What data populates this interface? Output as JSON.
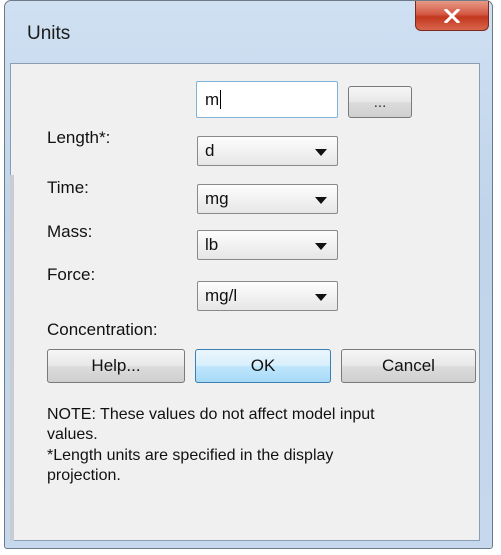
{
  "window": {
    "title": "Units"
  },
  "fields": {
    "length": {
      "label": "Length*:",
      "value": "m",
      "browse_label": "..."
    },
    "time": {
      "label": "Time:",
      "value": "d"
    },
    "mass": {
      "label": "Mass:",
      "value": "mg"
    },
    "force": {
      "label": "Force:",
      "value": "lb"
    },
    "concentration": {
      "label": "Concentration:",
      "value": "mg/l"
    }
  },
  "buttons": {
    "help": "Help...",
    "ok": "OK",
    "cancel": "Cancel"
  },
  "notes": {
    "line1": "NOTE: These values do not affect model input",
    "line2": "values.",
    "line3": "*Length units are specified in the display",
    "line4": "projection."
  }
}
